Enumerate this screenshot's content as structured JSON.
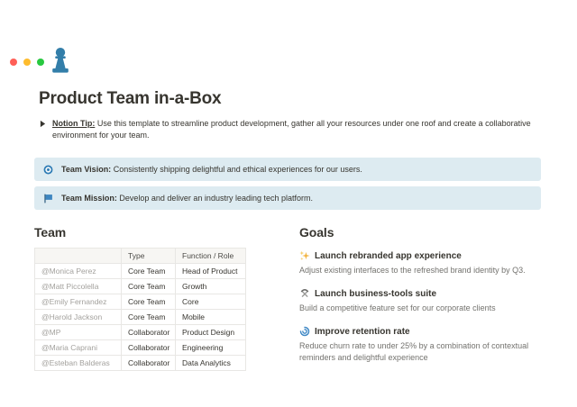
{
  "window": {
    "controls": {
      "close_color": "#ff5f57",
      "minimize_color": "#febc2e",
      "zoom_color": "#28c840"
    }
  },
  "page": {
    "icon": {
      "name": "pawn-icon",
      "glyph": "♟",
      "color": "#337ea9"
    },
    "title": "Product Team in-a-Box",
    "tip": {
      "label": "Notion Tip:",
      "text": "Use this template to streamline product development, gather all your resources under one roof and create a collaborative environment for your team."
    },
    "callouts": [
      {
        "icon": "compass-icon",
        "label": "Team Vision:",
        "text": "Consistently shipping delightful and ethical experiences for our users."
      },
      {
        "icon": "flag-icon",
        "label": "Team Mission:",
        "text": "Develop and deliver an industry leading tech platform."
      }
    ]
  },
  "team": {
    "heading": "Team",
    "table": {
      "headers": [
        "",
        "Type",
        "Function / Role"
      ],
      "rows": [
        {
          "name": "@Monica Perez",
          "type": "Core Team",
          "role": "Head of Product"
        },
        {
          "name": "@Matt Piccolella",
          "type": "Core Team",
          "role": "Growth"
        },
        {
          "name": "@Emily Fernandez",
          "type": "Core Team",
          "role": "Core"
        },
        {
          "name": "@Harold Jackson",
          "type": "Core Team",
          "role": "Mobile"
        },
        {
          "name": "@MP",
          "type": "Collaborator",
          "role": "Product Design"
        },
        {
          "name": "@Maria Caprani",
          "type": "Collaborator",
          "role": "Engineering"
        },
        {
          "name": "@Esteban Balderas",
          "type": "Collaborator",
          "role": "Data Analytics"
        }
      ]
    }
  },
  "goals": {
    "heading": "Goals",
    "items": [
      {
        "icon": "sparkles-icon",
        "title": "Launch rebranded app experience",
        "description": "Adjust existing interfaces to the refreshed brand identity by Q3."
      },
      {
        "icon": "hammer-and-pick-icon",
        "title": "Launch business-tools suite",
        "description": "Build a competitive feature set for our corporate clients"
      },
      {
        "icon": "swirl-icon",
        "title": "Improve retention rate",
        "description": "Reduce churn rate to under 25% by a combination of contextual reminders and delightful experience"
      }
    ]
  },
  "colors": {
    "accent_blue": "#337ea9",
    "callout_bg": "#ddebf1",
    "text": "#37352f",
    "muted_text": "#73726e",
    "table_border": "#e8e7e4",
    "table_header_bg": "#f7f6f3",
    "mention_gray": "#a3a19d",
    "sparkles_yellow": "#f2b33d",
    "tools_gray": "#8f8f8d"
  }
}
